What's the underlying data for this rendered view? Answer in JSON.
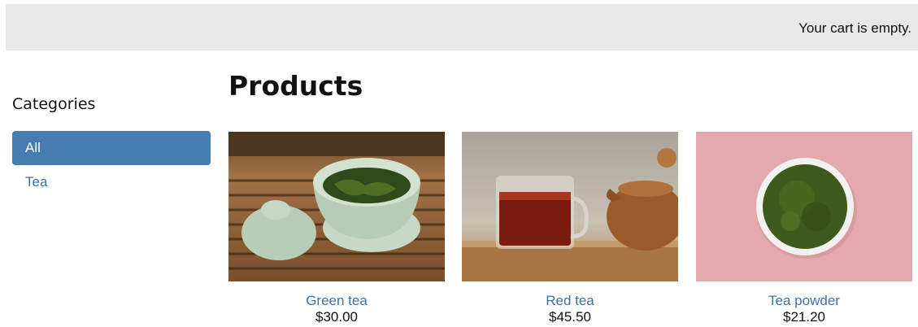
{
  "header": {
    "cart_status": "Your cart is empty."
  },
  "sidebar": {
    "title": "Categories",
    "items": [
      {
        "label": "All",
        "active": true
      },
      {
        "label": "Tea",
        "active": false
      }
    ]
  },
  "main": {
    "title": "Products",
    "products": [
      {
        "name": "Green tea",
        "price": "$30.00",
        "image": "gaiwan-green-tea-image"
      },
      {
        "name": "Red tea",
        "price": "$45.50",
        "image": "red-tea-glass-teapot-image"
      },
      {
        "name": "Tea powder",
        "price": "$21.20",
        "image": "matcha-bowl-image"
      }
    ]
  },
  "colors": {
    "accent": "#457db0",
    "link": "#3b73a6",
    "topbar_bg": "#e8e8e8"
  }
}
